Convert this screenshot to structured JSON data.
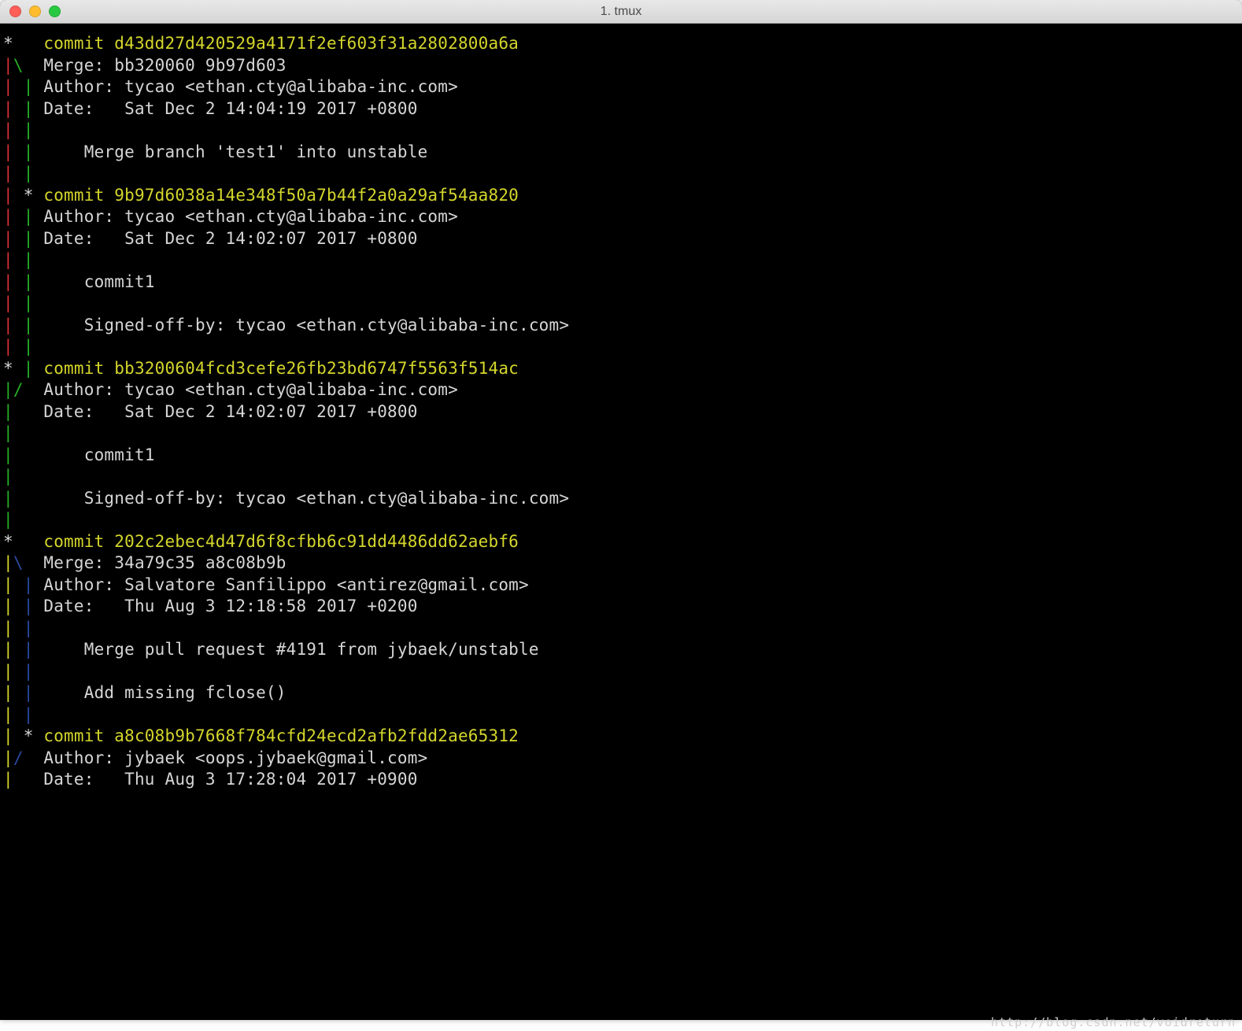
{
  "window": {
    "title": "1. tmux"
  },
  "traffic": {
    "close": "close-icon",
    "min": "minimize-icon",
    "max": "maximize-icon"
  },
  "log": {
    "c1": {
      "graph1a": "*",
      "graph1b": "   ",
      "commit_label": "commit ",
      "hash": "d43dd27d420529a4171f2ef603f31a2802800a6a",
      "graph2a": "|",
      "graph2b": "\\",
      "graph2c": "  ",
      "merge": "Merge: bb320060 9b97d603",
      "graph3a": "|",
      "graph3b": " ",
      "graph3c": "|",
      "graph3d": " ",
      "author": "Author: tycao <ethan.cty@alibaba-inc.com>",
      "date": "Date:   Sat Dec 2 14:04:19 2017 +0800",
      "msg1": "    Merge branch 'test1' into unstable"
    },
    "c2": {
      "graph1a": "|",
      "graph1b": " ",
      "graph1c": "*",
      "graph1d": " ",
      "commit_label": "commit ",
      "hash": "9b97d6038a14e348f50a7b44f2a0a29af54aa820",
      "graphLa": "|",
      "graphLb": " ",
      "graphLc": "|",
      "graphLd": " ",
      "author": "Author: tycao <ethan.cty@alibaba-inc.com>",
      "date": "Date:   Sat Dec 2 14:02:07 2017 +0800",
      "msg1": "    commit1",
      "msg2": "    Signed-off-by: tycao <ethan.cty@alibaba-inc.com>"
    },
    "c3": {
      "graph1a": "*",
      "graph1b": " ",
      "graph1c": "|",
      "graph1d": " ",
      "commit_label": "commit ",
      "hash": "bb3200604fcd3cefe26fb23bd6747f5563f514ac",
      "graph2a": "|",
      "graph2b": "/",
      "graph2c": "  ",
      "graphLa": "|",
      "graphLb": "   ",
      "author": "Author: tycao <ethan.cty@alibaba-inc.com>",
      "date": "Date:   Sat Dec 2 14:02:07 2017 +0800",
      "msg1": "    commit1",
      "msg2": "    Signed-off-by: tycao <ethan.cty@alibaba-inc.com>"
    },
    "c4": {
      "graph1a": "*",
      "graph1b": "   ",
      "commit_label": "commit ",
      "hash": "202c2ebec4d47d6f8cfbb6c91dd4486dd62aebf6",
      "graph2a": "|",
      "graph2b": "\\",
      "graph2c": "  ",
      "merge": "Merge: 34a79c35 a8c08b9b",
      "graphLa": "|",
      "graphLb": " ",
      "graphLc": "|",
      "graphLd": " ",
      "author": "Author: Salvatore Sanfilippo <antirez@gmail.com>",
      "date": "Date:   Thu Aug 3 12:18:58 2017 +0200",
      "msg1": "    Merge pull request #4191 from jybaek/unstable",
      "msg2": "    Add missing fclose()"
    },
    "c5": {
      "graph1a": "|",
      "graph1b": " ",
      "graph1c": "*",
      "graph1d": " ",
      "commit_label": "commit ",
      "hash": "a8c08b9b7668f784cfd24ecd2afb2fdd2ae65312",
      "graph2a": "|",
      "graph2b": "/",
      "graph2c": "  ",
      "graphLa": "|",
      "graphLb": "   ",
      "author": "Author: jybaek <oops.jybaek@gmail.com>",
      "date": "Date:   Thu Aug 3 17:28:04 2017 +0900"
    }
  },
  "watermark": "http://blog.csdn.net/voidreturn"
}
